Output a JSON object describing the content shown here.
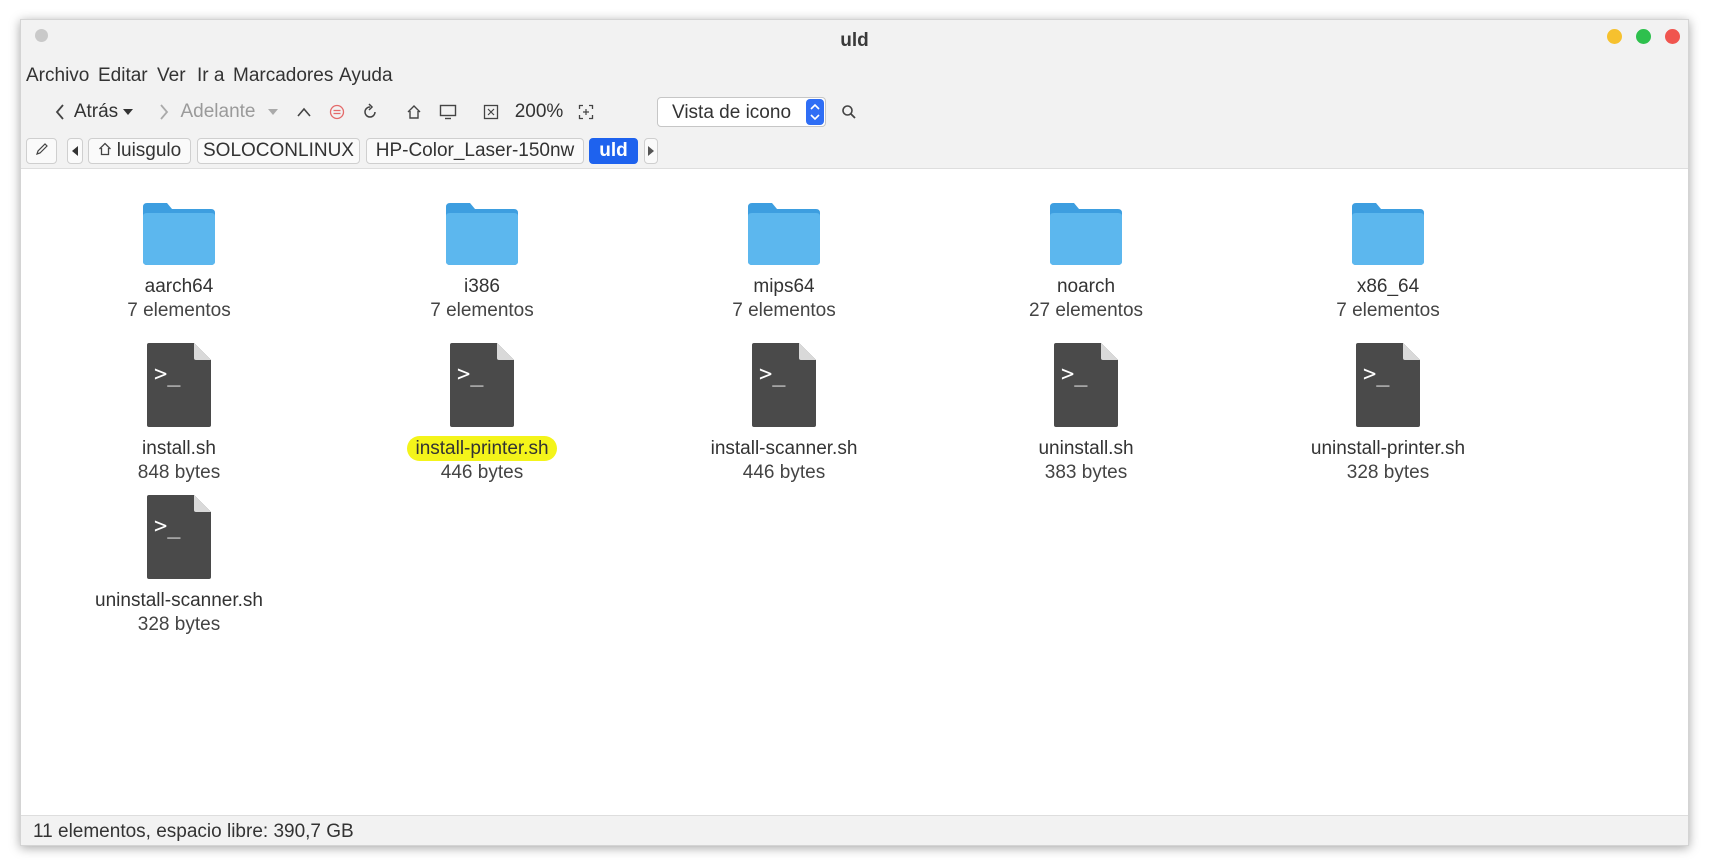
{
  "window": {
    "title": "uld"
  },
  "menu": [
    "Archivo",
    "Editar",
    "Ver",
    "Ir a",
    "Marcadores",
    "Ayuda"
  ],
  "toolbar": {
    "back_label": "Atrás",
    "forward_label": "Adelante",
    "zoom": "200%",
    "view_mode": "Vista de icono"
  },
  "breadcrumb": [
    "luisgulo",
    "SOLOCONLINUX",
    "HP-Color_Laser-150nw",
    "uld"
  ],
  "items": [
    {
      "name": "aarch64",
      "meta": "7 elementos",
      "type": "folder"
    },
    {
      "name": "i386",
      "meta": "7 elementos",
      "type": "folder"
    },
    {
      "name": "mips64",
      "meta": "7 elementos",
      "type": "folder"
    },
    {
      "name": "noarch",
      "meta": "27 elementos",
      "type": "folder"
    },
    {
      "name": "x86_64",
      "meta": "7 elementos",
      "type": "folder"
    },
    {
      "name": "install.sh",
      "meta": "848 bytes",
      "type": "script"
    },
    {
      "name": "install-printer.sh",
      "meta": "446 bytes",
      "type": "script",
      "highlighted": true
    },
    {
      "name": "install-scanner.sh",
      "meta": "446 bytes",
      "type": "script"
    },
    {
      "name": "uninstall.sh",
      "meta": "383 bytes",
      "type": "script"
    },
    {
      "name": "uninstall-printer.sh",
      "meta": "328 bytes",
      "type": "script"
    },
    {
      "name": "uninstall-scanner.sh",
      "meta": "328 bytes",
      "type": "script"
    }
  ],
  "status": "11 elementos, espacio libre: 390,7 GB",
  "colors": {
    "accent": "#1e62ee",
    "folder": "#4ea8e6",
    "highlight": "#f4f41a"
  }
}
